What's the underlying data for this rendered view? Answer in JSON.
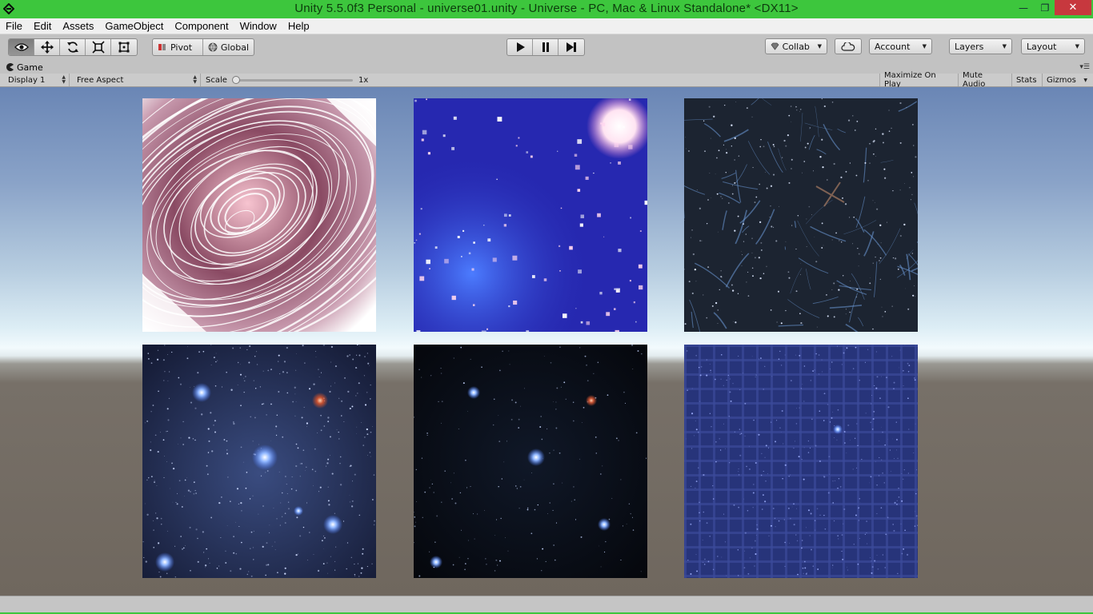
{
  "window": {
    "title": "Unity 5.5.0f3 Personal - universe01.unity - Universe - PC, Mac & Linux Standalone* <DX11>",
    "minimize_glyph": "—",
    "maximize_glyph": "❐",
    "close_glyph": "✕"
  },
  "menu": {
    "items": [
      "File",
      "Edit",
      "Assets",
      "GameObject",
      "Component",
      "Window",
      "Help"
    ]
  },
  "toolbar": {
    "transform_tools": [
      "view-hand-icon",
      "move-icon",
      "rotate-icon",
      "scale-icon",
      "rect-icon"
    ],
    "active_tool": 0,
    "pivot_label": "Pivot",
    "global_label": "Global",
    "collab_label": "Collab",
    "account_label": "Account",
    "layers_label": "Layers",
    "layout_label": "Layout"
  },
  "tab": {
    "label": "Game"
  },
  "gamebar": {
    "display_label": "Display 1",
    "aspect_label": "Free Aspect",
    "scale_label": "Scale",
    "scale_value": "1x",
    "scale_fraction": 0.0,
    "maximize_label": "Maximize On Play",
    "mute_label": "Mute Audio",
    "stats_label": "Stats",
    "gizmos_label": "Gizmos"
  },
  "colors": {
    "title_bar": "#3dc63d",
    "close_button": "#c7383e",
    "editor_gray": "#c2c2c2"
  },
  "tiles": [
    {
      "name": "warp-rings-texture"
    },
    {
      "name": "blue-nebula-texture"
    },
    {
      "name": "streak-starfield-texture"
    },
    {
      "name": "bright-starfield-texture"
    },
    {
      "name": "dark-starfield-texture"
    },
    {
      "name": "grid-starfield-texture"
    }
  ]
}
